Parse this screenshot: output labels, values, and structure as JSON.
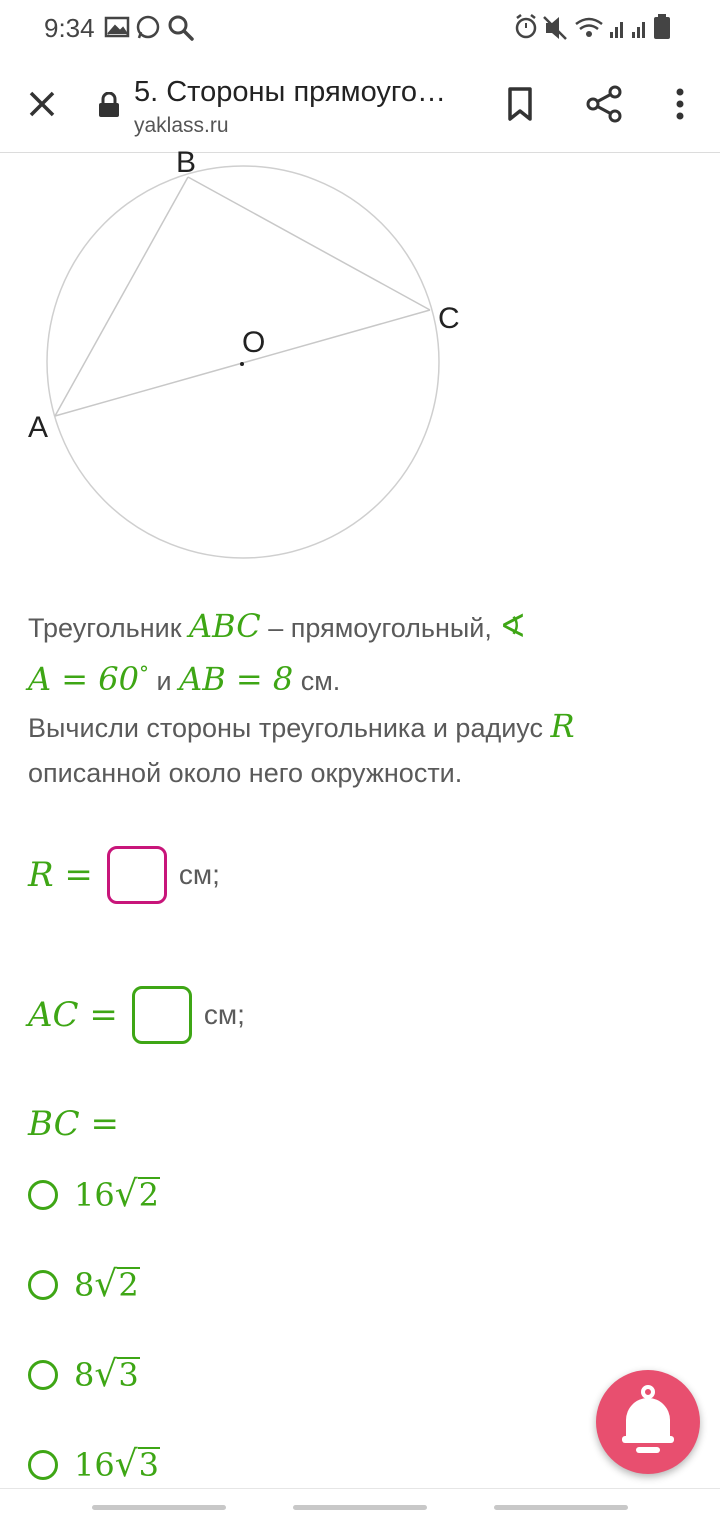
{
  "status_bar": {
    "time": "9:34"
  },
  "toolbar": {
    "title": "5. Стороны прямоуго…",
    "url": "yaklass.ru"
  },
  "diagram": {
    "labels": {
      "A": "A",
      "B": "B",
      "C": "C",
      "O": "O"
    }
  },
  "problem": {
    "t1": "Треугольник ",
    "abc": "ABC",
    "t2": " – прямоугольный, ",
    "angle_sym": "∢",
    "a_eq": "A = 60",
    "deg": "°",
    "t3": " и ",
    "ab_eq": "AB = 8",
    "t4": " см.",
    "t5": "Вычисли стороны треугольника и радиус ",
    "r": "R",
    "t6": "описанной около него окружности."
  },
  "answers": {
    "r": {
      "label": "R =",
      "unit": "см;",
      "border": "#c8157a"
    },
    "ac": {
      "label": "AC =",
      "unit": "см;",
      "border": "#3ea615"
    }
  },
  "bc": {
    "label": "BC =",
    "options": [
      {
        "coef": "16",
        "radicand": "2"
      },
      {
        "coef": "8",
        "radicand": "2"
      },
      {
        "coef": "8",
        "radicand": "3"
      },
      {
        "coef": "16",
        "radicand": "3"
      }
    ]
  },
  "colors": {
    "accent": "#3ea615",
    "magenta": "#c8157a",
    "fab": "#e84f6f"
  },
  "icons": [
    "close-icon",
    "lock-icon",
    "bookmark-icon",
    "share-icon",
    "more-vert-icon",
    "bell-icon"
  ]
}
